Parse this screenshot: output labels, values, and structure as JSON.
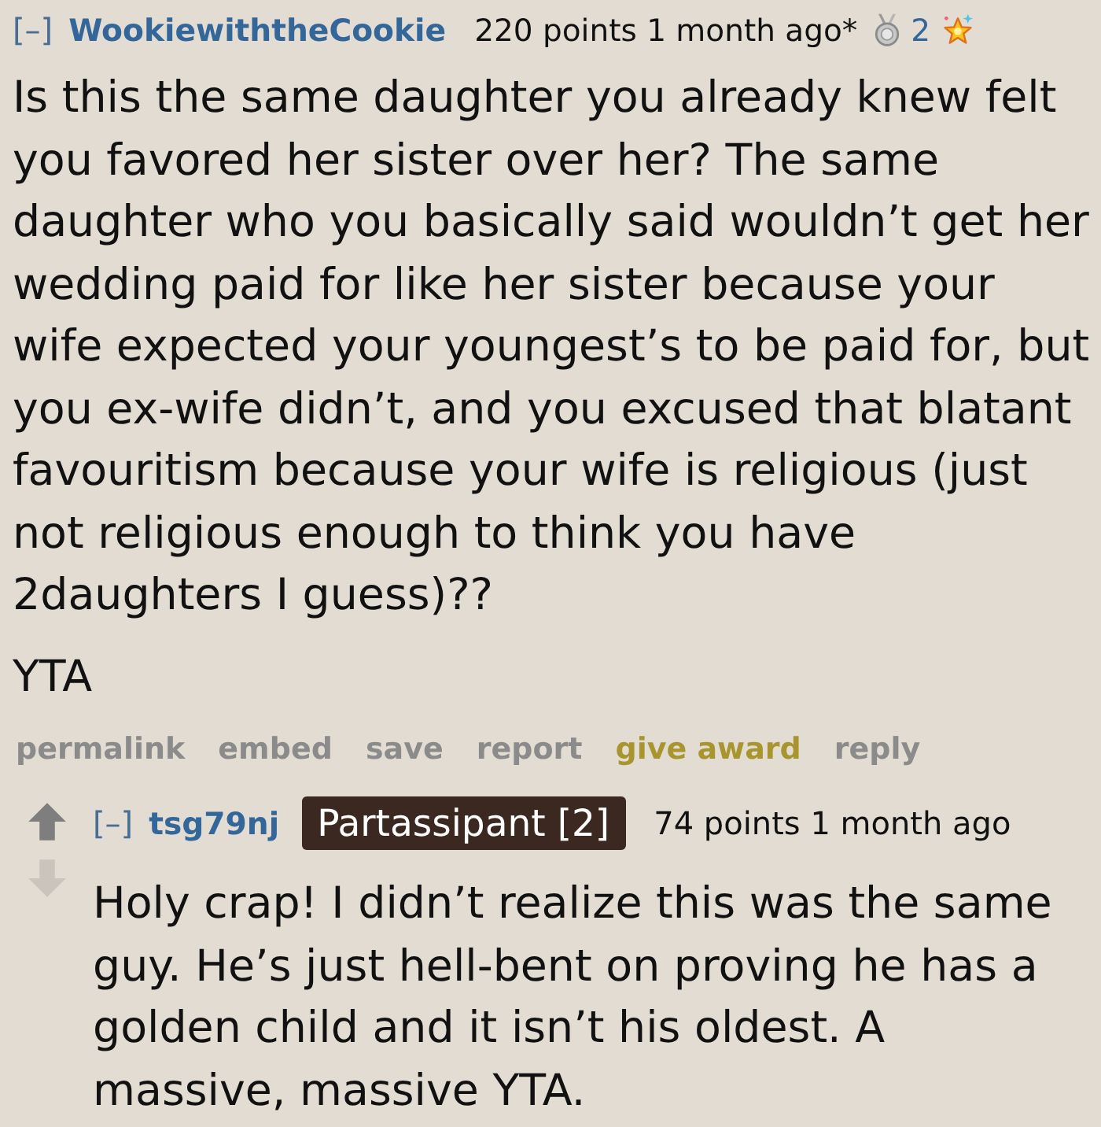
{
  "comment": {
    "collapse_toggle": "[–]",
    "author": "WookiewiththeCookie",
    "score": "220 points",
    "time": "1 month ago",
    "edited_mark": "*",
    "awards": [
      {
        "kind": "medal",
        "count": "2"
      },
      {
        "kind": "star"
      }
    ],
    "body": [
      "Is this the same daughter you already knew felt you favored her sister over her? The same daughter who you basically said wouldn’t get her wedding paid for like her sister because your wife expected your youngest’s to be paid for, but you ex-wife didn’t, and you excused that blatant favouritism because your wife is religious (just not religious enough to think you have 2daughters I guess)??",
      "YTA"
    ],
    "actions": [
      {
        "label": "permalink",
        "kind": "link"
      },
      {
        "label": "embed",
        "kind": "link"
      },
      {
        "label": "save",
        "kind": "link"
      },
      {
        "label": "report",
        "kind": "link"
      },
      {
        "label": "give award",
        "kind": "award"
      },
      {
        "label": "reply",
        "kind": "link"
      }
    ]
  },
  "reply": {
    "collapse_toggle": "[–]",
    "author": "tsg79nj",
    "flair": "Partassipant [2]",
    "score": "74 points",
    "time": "1 month ago",
    "body": [
      "Holy crap! I didn’t realize this was the same guy. He’s just hell-bent on proving he has a golden child and it isn’t his oldest. A massive, massive YTA."
    ]
  }
}
